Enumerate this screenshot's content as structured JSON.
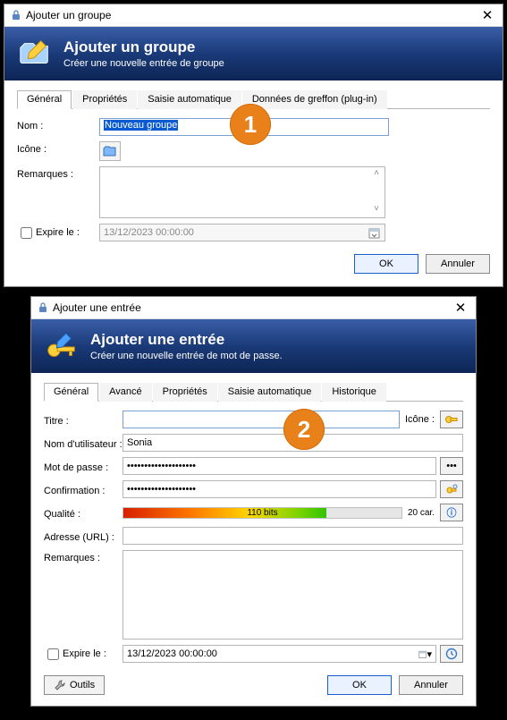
{
  "badge1": "1",
  "badge2": "2",
  "win1": {
    "title": "Ajouter un groupe",
    "hdr_title": "Ajouter un groupe",
    "hdr_sub": "Créer une nouvelle entrée de groupe",
    "tabs": [
      "Général",
      "Propriétés",
      "Saisie automatique",
      "Données de greffon (plug-in)"
    ],
    "labels": {
      "name": "Nom :",
      "icon": "Icône :",
      "remarks": "Remarques :",
      "expires": "Expire le :"
    },
    "name_value": "Nouveau groupe",
    "expire_value": "13/12/2023 00:00:00",
    "buttons": {
      "ok": "OK",
      "cancel": "Annuler"
    }
  },
  "win2": {
    "title": "Ajouter une entrée",
    "hdr_title": "Ajouter une entrée",
    "hdr_sub": "Créer une nouvelle entrée de mot de passe.",
    "tabs": [
      "Général",
      "Avancé",
      "Propriétés",
      "Saisie automatique",
      "Historique"
    ],
    "labels": {
      "title": "Titre :",
      "icon": "Icône :",
      "username": "Nom d'utilisateur :",
      "password": "Mot de passe :",
      "confirm": "Confirmation :",
      "quality": "Qualité :",
      "url": "Adresse (URL) :",
      "remarks": "Remarques :",
      "expires": "Expire le :"
    },
    "title_value": "",
    "username_value": "Sonia",
    "password_value": "••••••••••••••••••••",
    "confirm_value": "••••••••••••••••••••",
    "quality_bits": "110 bits",
    "quality_chars": "20 car.",
    "expire_value": "13/12/2023 00:00:00",
    "buttons": {
      "tools": "Outils",
      "ok": "OK",
      "cancel": "Annuler"
    }
  }
}
